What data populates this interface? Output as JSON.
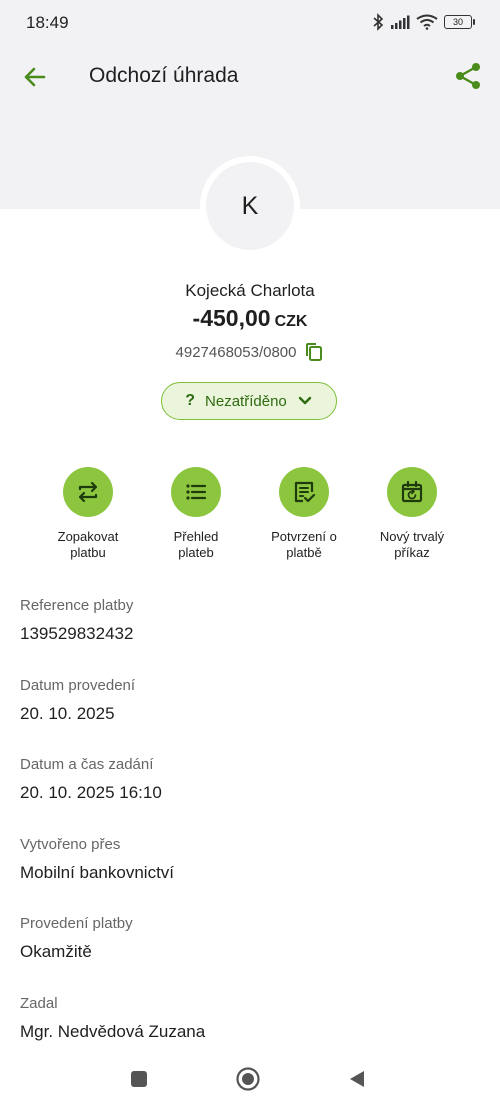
{
  "status_bar": {
    "time": "18:49",
    "battery": "30"
  },
  "header": {
    "title": "Odchozí úhrada"
  },
  "avatar": {
    "initial": "K"
  },
  "payment": {
    "name": "Kojecká Charlota",
    "amount": "-450,00",
    "currency": "CZK",
    "account": "4927468053/0800"
  },
  "category": {
    "label": "Nezatříděno",
    "symbol": "?"
  },
  "actions": [
    {
      "label": "Zopakovat\nplatbu",
      "icon": "repeat-icon"
    },
    {
      "label": "Přehled\nplateb",
      "icon": "list-icon"
    },
    {
      "label": "Potvrzení o\nplatbě",
      "icon": "receipt-check-icon"
    },
    {
      "label": "Nový trvalý\npříkaz",
      "icon": "calendar-repeat-icon"
    }
  ],
  "details": [
    {
      "label": "Reference platby",
      "value": "139529832432"
    },
    {
      "label": "Datum provedení",
      "value": "20. 10. 2025"
    },
    {
      "label": "Datum a čas zadání",
      "value": "20. 10. 2025 16:10"
    },
    {
      "label": "Vytvořeno přes",
      "value": "Mobilní bankovnictví"
    },
    {
      "label": "Provedení platby",
      "value": "Okamžitě"
    },
    {
      "label": "Zadal",
      "value": "Mgr. Nedvědová Zuzana"
    }
  ],
  "colors": {
    "accent": "#4a8c1c",
    "action_bg": "#8cc63f",
    "chip_bg": "#eaf5dc",
    "header_bg": "#f2f2f4"
  }
}
